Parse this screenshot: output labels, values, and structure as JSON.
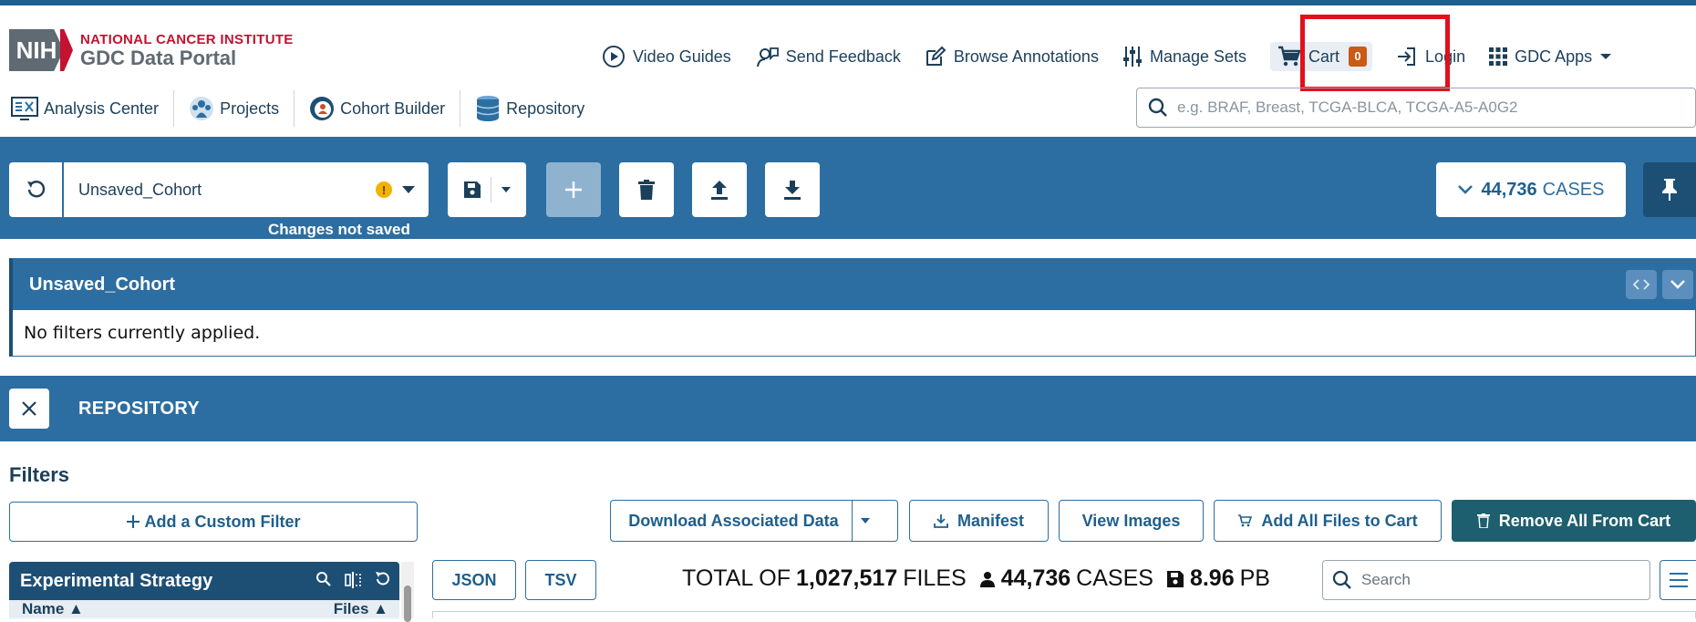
{
  "brand": {
    "nih": "NIH",
    "institute": "NATIONAL CANCER INSTITUTE",
    "portal": "GDC Data Portal"
  },
  "topnav": {
    "video_guides": "Video Guides",
    "send_feedback": "Send Feedback",
    "browse_annotations": "Browse Annotations",
    "manage_sets": "Manage Sets",
    "cart": "Cart",
    "cart_count": "0",
    "login": "Login",
    "gdc_apps": "GDC Apps"
  },
  "subnav": {
    "analysis_center": "Analysis Center",
    "projects": "Projects",
    "cohort_builder": "Cohort Builder",
    "repository": "Repository"
  },
  "search": {
    "placeholder": "e.g. BRAF, Breast, TCGA-BLCA, TCGA-A5-A0G2"
  },
  "cohort_bar": {
    "cohort_name": "Unsaved_Cohort",
    "changes_note": "Changes not saved",
    "cases_count": "44,736",
    "cases_label": "CASES"
  },
  "cohort_panel": {
    "title": "Unsaved_Cohort",
    "empty_message": "No filters currently applied."
  },
  "repository": {
    "title": "REPOSITORY"
  },
  "filters": {
    "title": "Filters",
    "add_custom": "Add a Custom Filter",
    "facet_title": "Experimental Strategy",
    "col_name": "Name",
    "col_files": "Files"
  },
  "actions": {
    "download_associated": "Download Associated Data",
    "manifest": "Manifest",
    "view_images": "View Images",
    "add_all": "Add All Files to Cart",
    "remove_all": "Remove All From Cart"
  },
  "table": {
    "json": "JSON",
    "tsv": "TSV",
    "total_of": "TOTAL OF",
    "files_count": "1,027,517",
    "files_label": "FILES",
    "cases_count": "44,736",
    "cases_label": "CASES",
    "size_value": "8.96",
    "size_unit": "PB",
    "search_placeholder": "Search"
  },
  "colors": {
    "primary": "#2c6ea1",
    "dark": "#1d4f75",
    "remove_button": "#1d5f6e",
    "highlight": "#e1101a",
    "badge": "#cb5a16"
  }
}
